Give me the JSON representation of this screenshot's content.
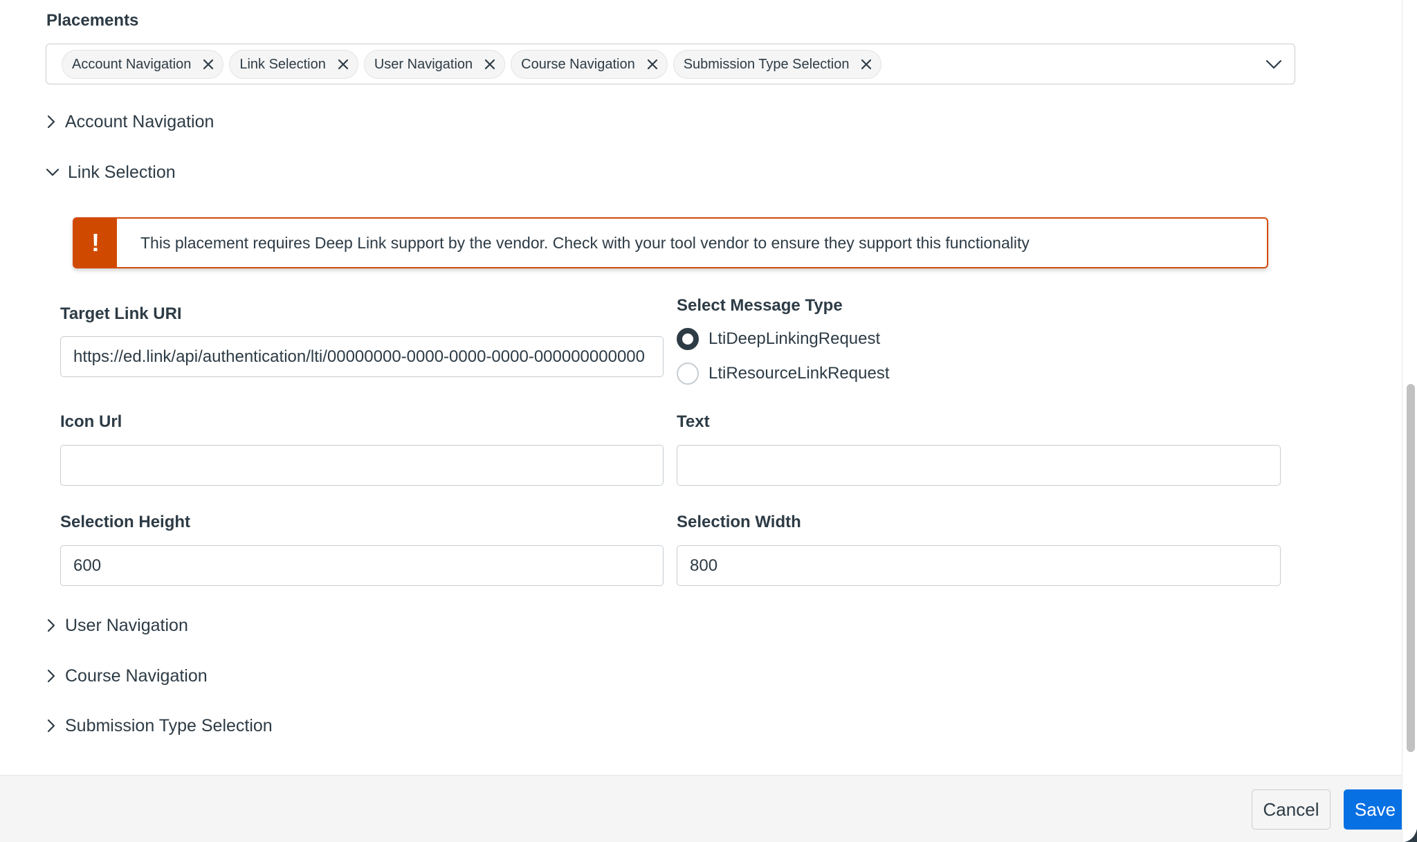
{
  "placements": {
    "label": "Placements",
    "selected": [
      {
        "label": "Account Navigation"
      },
      {
        "label": "Link Selection"
      },
      {
        "label": "User Navigation"
      },
      {
        "label": "Course Navigation"
      },
      {
        "label": "Submission Type Selection"
      }
    ]
  },
  "sections": {
    "account_navigation": {
      "label": "Account Navigation",
      "expanded": false
    },
    "link_selection": {
      "label": "Link Selection",
      "expanded": true
    },
    "user_navigation": {
      "label": "User Navigation",
      "expanded": false
    },
    "course_navigation": {
      "label": "Course Navigation",
      "expanded": false
    },
    "submission_type_selection": {
      "label": "Submission Type Selection",
      "expanded": false
    }
  },
  "alert": {
    "icon": "!",
    "text": "This placement requires Deep Link support by the vendor. Check with your tool vendor to ensure they support this functionality",
    "color": "#cf4a00"
  },
  "form": {
    "target_link_uri": {
      "label": "Target Link URI",
      "value": "https://ed.link/api/authentication/lti/00000000-0000-0000-0000-000000000000"
    },
    "message_type": {
      "label": "Select Message Type",
      "options": [
        {
          "label": "LtiDeepLinkingRequest",
          "checked": true
        },
        {
          "label": "LtiResourceLinkRequest",
          "checked": false
        }
      ]
    },
    "icon_url": {
      "label": "Icon Url",
      "value": ""
    },
    "text": {
      "label": "Text",
      "value": ""
    },
    "selection_height": {
      "label": "Selection Height",
      "value": "600"
    },
    "selection_width": {
      "label": "Selection Width",
      "value": "800"
    }
  },
  "footer": {
    "cancel_label": "Cancel",
    "save_label": "Save",
    "save_color": "#0770e3"
  },
  "icons": {
    "remove": "x-icon",
    "dropdown": "chevron-down-icon",
    "collapsed": "chevron-right-icon",
    "expanded": "chevron-down-icon"
  }
}
